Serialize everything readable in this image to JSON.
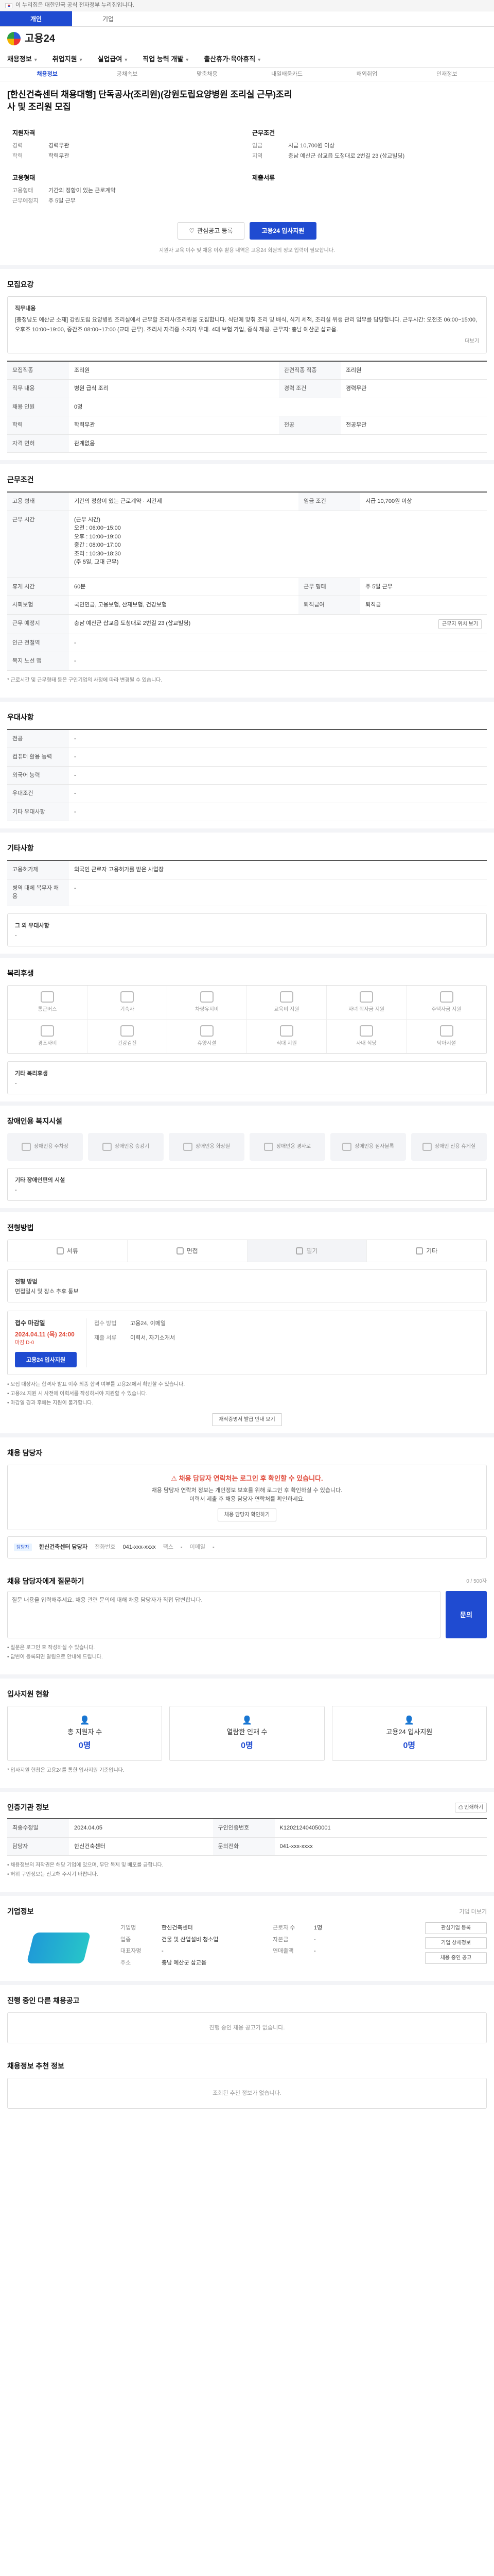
{
  "topbar": {
    "text": "이 누리집은 대한민국 공식 전자정부 누리집입니다."
  },
  "tabs": [
    {
      "label": "개인",
      "on": true
    },
    {
      "label": "기업",
      "on": false
    }
  ],
  "header": {
    "logo": "고용24"
  },
  "gnb": [
    "채용정보",
    "취업지원",
    "실업급여",
    "직업 능력 개발",
    "출산휴가·육아휴직"
  ],
  "subnav": [
    {
      "label": "채용정보",
      "on": true
    },
    {
      "label": "공채속보"
    },
    {
      "label": "맞춤채용"
    },
    {
      "label": "내일배움카드"
    },
    {
      "label": "해외취업"
    },
    {
      "label": "인재정보"
    }
  ],
  "job": {
    "title": "[한신건축센터 채용대행] 단독공사(조리원)(강원도립요양병원 조리실 근무)조리사 및 조리원 모집",
    "summary": {
      "left_heading": "지원자격",
      "left": [
        [
          "경력",
          "경력무관"
        ],
        [
          "학력",
          "학력무관"
        ]
      ],
      "left2_heading": "고용형태",
      "left2": [
        [
          "고용형태",
          "기간의 정함이 있는 근로계약"
        ],
        [
          "근무예정지",
          "주 5일 근무"
        ]
      ],
      "right_heading": "근무조건",
      "right": [
        [
          "임금",
          "시급 10,700원 이상"
        ],
        [
          "지역",
          "충남 예산군 삽교읍 도청대로 2번길 23 (삽교빌딩)"
        ]
      ],
      "right2_heading": "제출서류",
      "right2": [
        [
          "",
          ""
        ]
      ]
    },
    "btn_interest": "관심공고 등록",
    "btn_apply": "고용24 입사지원",
    "apply_note": "지원자 교육 이수 및 채용 이후 활용 내역은 고용24 회원의 정보 입력이 필요합니다."
  },
  "recruit": {
    "heading": "모집요강",
    "desc_title": "직무내용",
    "desc": "[충청남도 예산군 소재] 강원도립 요양병원 조리실에서 근무할 조리사/조리원을 모집합니다. 식단에 맞춰 조리 및 배식, 식기 세척, 조리실 위생 관리 업무를 담당합니다. 근무시간: 오전조 06:00~15:00, 오후조 10:00~19:00, 중간조 08:00~17:00 (교대 근무). 조리사 자격증 소지자 우대. 4대 보험 가입, 중식 제공. 근무지: 충남 예산군 삽교읍.",
    "more": "더보기",
    "rows": [
      [
        "모집직종",
        "조리원",
        "관련직종 직종",
        "조리원"
      ],
      [
        "직무 내용",
        "병원 급식 조리",
        "경력 조건",
        "경력무관"
      ],
      [
        "채용 인원",
        "0명",
        "",
        ""
      ],
      [
        "학력",
        "학력무관",
        "전공",
        "전공무관"
      ],
      [
        "자격 면허",
        "관계없음",
        "",
        ""
      ]
    ]
  },
  "conditions": {
    "heading": "근무조건",
    "rows": [
      {
        "k": "고용 형태",
        "v": "기간의 정함이 있는 근로계약 · 시간제",
        "k2": "임금 조건",
        "v2": "시급 10,700원 이상"
      },
      {
        "k": "근무 시간",
        "v": "(근무 시간)\n오전 : 06:00~15:00\n오후 : 10:00~19:00\n중간 : 08:00~17:00\n조리 : 10:30~18:30\n(주 5일, 교대 근무)",
        "k2": "",
        "v2": ""
      },
      {
        "k": "휴게 시간",
        "v": "60분",
        "k2": "근무 형태",
        "v2": "주 5일 근무"
      },
      {
        "k": "사회보험",
        "v": "국민연금, 고용보험, 산재보험, 건강보험",
        "k2": "퇴직급여",
        "v2": "퇴직금"
      },
      {
        "k": "근무 예정지",
        "v": "충남 예산군 삽교읍 도청대로 2번길 23 (삽교빌딩)",
        "k2": "",
        "v2": ""
      },
      {
        "k": "인근 전철역",
        "v": "-",
        "k2": "",
        "v2": ""
      },
      {
        "k": "복지 노선 맵",
        "v": "-",
        "k2": "",
        "v2": ""
      }
    ],
    "map_btn": "근무지 위치 보기",
    "footnote": "* 근로시간 및 근무형태 등은 구인기업의 사정에 따라 변경될 수 있습니다."
  },
  "preference": {
    "heading": "우대사항",
    "rows": [
      [
        "전공",
        "-"
      ],
      [
        "컴퓨터 활용 능력",
        "-"
      ],
      [
        "외국어 능력",
        "-"
      ],
      [
        "우대조건",
        "-"
      ],
      [
        "기타 우대사항",
        "-"
      ]
    ]
  },
  "extra": {
    "heading": "기타사항",
    "rows": [
      [
        "고용허가제",
        "외국인 근로자 고용허가를 받은 사업장"
      ],
      [
        "병역 대체 복무자 채용",
        "-"
      ]
    ],
    "extra_label": "그 외 우대사항",
    "extra_value": "-"
  },
  "welfare": {
    "heading": "복리후생",
    "items": [
      "통근버스",
      "기숙사",
      "차량유지비",
      "교육비 지원",
      "자녀 학자금 지원",
      "주택자금 지원",
      "경조사비",
      "건강검진",
      "휴양시설",
      "식대 지원",
      "사내 식당",
      "탁아시설"
    ],
    "other_label": "기타 복리후생",
    "other_value": "-"
  },
  "disabled": {
    "heading": "장애인용 복지시설",
    "items": [
      "장애인용 주차장",
      "장애인용 승강기",
      "장애인용 화장실",
      "장애인용 경사로",
      "장애인용 점자블록",
      "장애인 전용 휴게실"
    ],
    "other_label": "기타 장애인편의 시설",
    "other_value": "-"
  },
  "selection": {
    "heading": "전형방법",
    "steps": [
      "서류",
      "면접",
      "필기",
      "기타"
    ],
    "steps_on": [
      false,
      false,
      true,
      false
    ],
    "method_label": "전형 방법",
    "method_value": "면접일시 및 장소 추후 통보"
  },
  "deadline": {
    "heading": "접수 마감일",
    "date": "2024.04.11 (목) 24:00",
    "dday": "마감 D-0",
    "apply_btn": "고용24 입사지원",
    "r1_k": "접수 방법",
    "r1_v": "고용24, 이메일",
    "r2_k": "제출 서류",
    "r2_v": "이력서, 자기소개서",
    "bullets": [
      "모집 대상자는 합격자 발표 이후 최종 합격 여부를 고용24에서 확인할 수 있습니다.",
      "고용24 지원 시 사전에 이력서를 작성하셔야 지원할 수 있습니다.",
      "마감일 경과 후에는 지원이 불가합니다."
    ],
    "certificate_btn": "재직증명서 발급 안내 보기"
  },
  "contact": {
    "heading": "채용 담당자",
    "warn": "채용 담당자 연락처는 로그인 후 확인할 수 있습니다.",
    "line1": "채용 담당자 연락처 정보는 개인정보 보호를 위해 로그인 후 확인하실 수 있습니다.",
    "line2": "이력서 제출 후 채용 담당자 연락처를 확인하세요.",
    "btn": "채용 담당자 확인하기",
    "tag": "담당자",
    "person": "한신건축센터 담당자",
    "phone_k": "전화번호",
    "phone": "041-xxx-xxxx",
    "fax_k": "팩스",
    "fax": "-",
    "email_k": "이메일",
    "email": "-"
  },
  "qa": {
    "heading": "채용 담당자에게 질문하기",
    "counter": "0 / 500자",
    "placeholder": "질문 내용을 입력해주세요. 채용 관련 문의에 대해 채용 담당자가 직접 답변합니다.",
    "btn": "문의",
    "notes": [
      "질문은 로그인 후 작성하실 수 있습니다.",
      "답변이 등록되면 알림으로 안내해 드립니다."
    ]
  },
  "stats": {
    "heading": "입사지원 현황",
    "items": [
      {
        "label": "총 지원자 수",
        "value": "0명"
      },
      {
        "label": "열람한 인재 수",
        "value": "0명"
      },
      {
        "label": "고용24 입사지원",
        "value": "0명"
      }
    ],
    "note": "* 입사지원 현황은 고용24를 통한 입사지원 기준입니다."
  },
  "info": {
    "heading": "인증기관 정보",
    "print_btn": "인쇄하기",
    "rows": [
      [
        "최종수정일",
        "2024.04.05",
        "구인인증번호",
        "K120212404050001"
      ],
      [
        "담당자",
        "한신건축센터",
        "문의전화",
        "041-xxx-xxxx"
      ]
    ],
    "bullets": [
      "채용정보의 저작권은 해당 기업에 있으며, 무단 복제 및 배포를 금합니다.",
      "허위 구인정보는 신고해 주시기 바랍니다."
    ]
  },
  "company": {
    "heading": "기업정보",
    "btn_more": "기업 더보기",
    "rows": [
      [
        "기업명",
        "한신건축센터"
      ],
      [
        "업종",
        "건물 및 산업설비 청소업"
      ],
      [
        "대표자명",
        "-"
      ],
      [
        "주소",
        "충남 예산군 삽교읍"
      ]
    ],
    "rows2": [
      [
        "근로자 수",
        "1명"
      ],
      [
        "자본금",
        "-"
      ],
      [
        "연매출액",
        "-"
      ]
    ],
    "side_btns": [
      "관심기업 등록",
      "기업 상세정보",
      "채용 중인 공고"
    ]
  },
  "other_jobs": {
    "heading": "진행 중인 다른 채용공고",
    "empty": "진행 중인 채용 공고가 없습니다."
  },
  "recommend": {
    "heading": "채용정보 추천 정보",
    "empty": "조회된 추천 정보가 없습니다."
  }
}
